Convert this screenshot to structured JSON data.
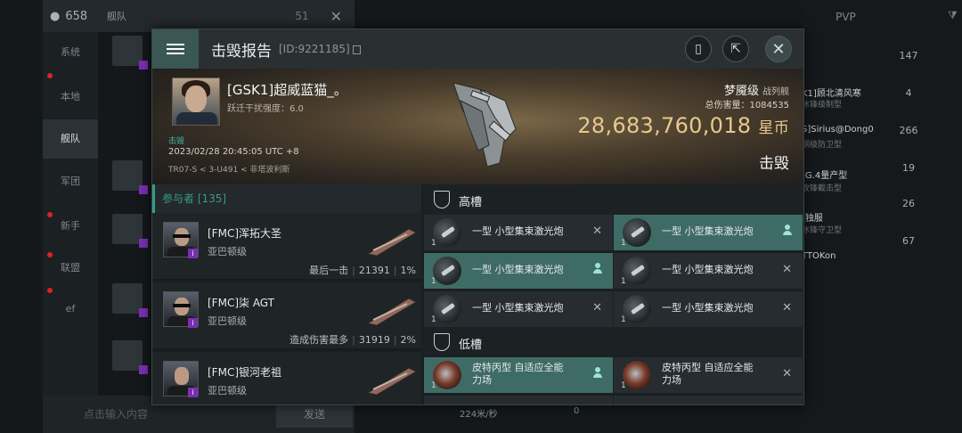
{
  "background": {
    "member_count": "658",
    "top_title": "舰队",
    "top_number": "51",
    "channels": [
      "系统",
      "本地",
      "舰队",
      "军团",
      "新手",
      "联盟",
      "ef"
    ],
    "local_badge": "1",
    "input_placeholder": "点击输入内容",
    "send_label": "发送",
    "bottom_info": "224米/秒",
    "bottom_zero": "0",
    "pvp_label": "PVP",
    "right_names": [
      "K1]顾北清风寒",
      "S]Sirius@Dong0",
      "]G.4量产型",
      "]独服",
      "TTOKon"
    ],
    "right_subs": [
      "冰锋级制型",
      "钢级防卫型",
      "攻锋截击型",
      "冰锋守卫型"
    ],
    "right_stats": [
      "147",
      "4",
      "266",
      "19",
      "26",
      "67"
    ]
  },
  "report": {
    "title": "击毁报告",
    "id_text": "[ID:9221185]",
    "pilot_name": "[GSK1]超威蓝猫_。",
    "jump_text": "跃迁干扰强度：6.0",
    "kill_tag": "击毁",
    "date": "2023/02/28 20:45:05 UTC +8",
    "location": "TR07-S < 3-U491 < 非塔波利斯",
    "ship_name": "梦魇级",
    "ship_class": "战列舰",
    "total_damage_label": "总伤害量：",
    "total_damage": "1084535",
    "isk_value": "28,683,760,018",
    "isk_unit": "星币",
    "result": "击毁"
  },
  "participants": {
    "header": "参与者 [135]",
    "rows": [
      {
        "name": "[FMC]浑拓大圣",
        "ship": "亚巴顿级",
        "stat_label": "最后一击",
        "damage": "21391",
        "percent": "1%"
      },
      {
        "name": "[FMC]柒 AGT",
        "ship": "亚巴顿级",
        "stat_label": "造成伤害最多",
        "damage": "31919",
        "percent": "2%"
      },
      {
        "name": "[FMC]银河老祖",
        "ship": "亚巴顿级",
        "stat_label": "",
        "damage": "",
        "percent": ""
      }
    ]
  },
  "slots": {
    "high_label": "高槽",
    "low_label": "低槽",
    "high": [
      {
        "name": "一型 小型集束激光炮",
        "qty": "1",
        "state": "destroyed-x"
      },
      {
        "name": "一型 小型集束激光炮",
        "qty": "1",
        "state": "dropped"
      },
      {
        "name": "一型 小型集束激光炮",
        "qty": "1",
        "state": "dropped"
      },
      {
        "name": "一型 小型集束激光炮",
        "qty": "1",
        "state": "destroyed-x"
      },
      {
        "name": "一型 小型集束激光炮",
        "qty": "1",
        "state": "destroyed-x"
      },
      {
        "name": "一型 小型集束激光炮",
        "qty": "1",
        "state": "destroyed-x"
      }
    ],
    "low": [
      {
        "name_line1": "皮特丙型 自适应全能",
        "name_line2": "力场",
        "qty": "1",
        "state": "dropped"
      },
      {
        "name_line1": "皮特丙型 自适应全能",
        "name_line2": "力场",
        "qty": "1",
        "state": "destroyed-x"
      }
    ]
  },
  "colors": {
    "accent": "#3a9a8a",
    "isk_gold": "#e7c98e",
    "dropped_bg": "#3f6b66"
  }
}
